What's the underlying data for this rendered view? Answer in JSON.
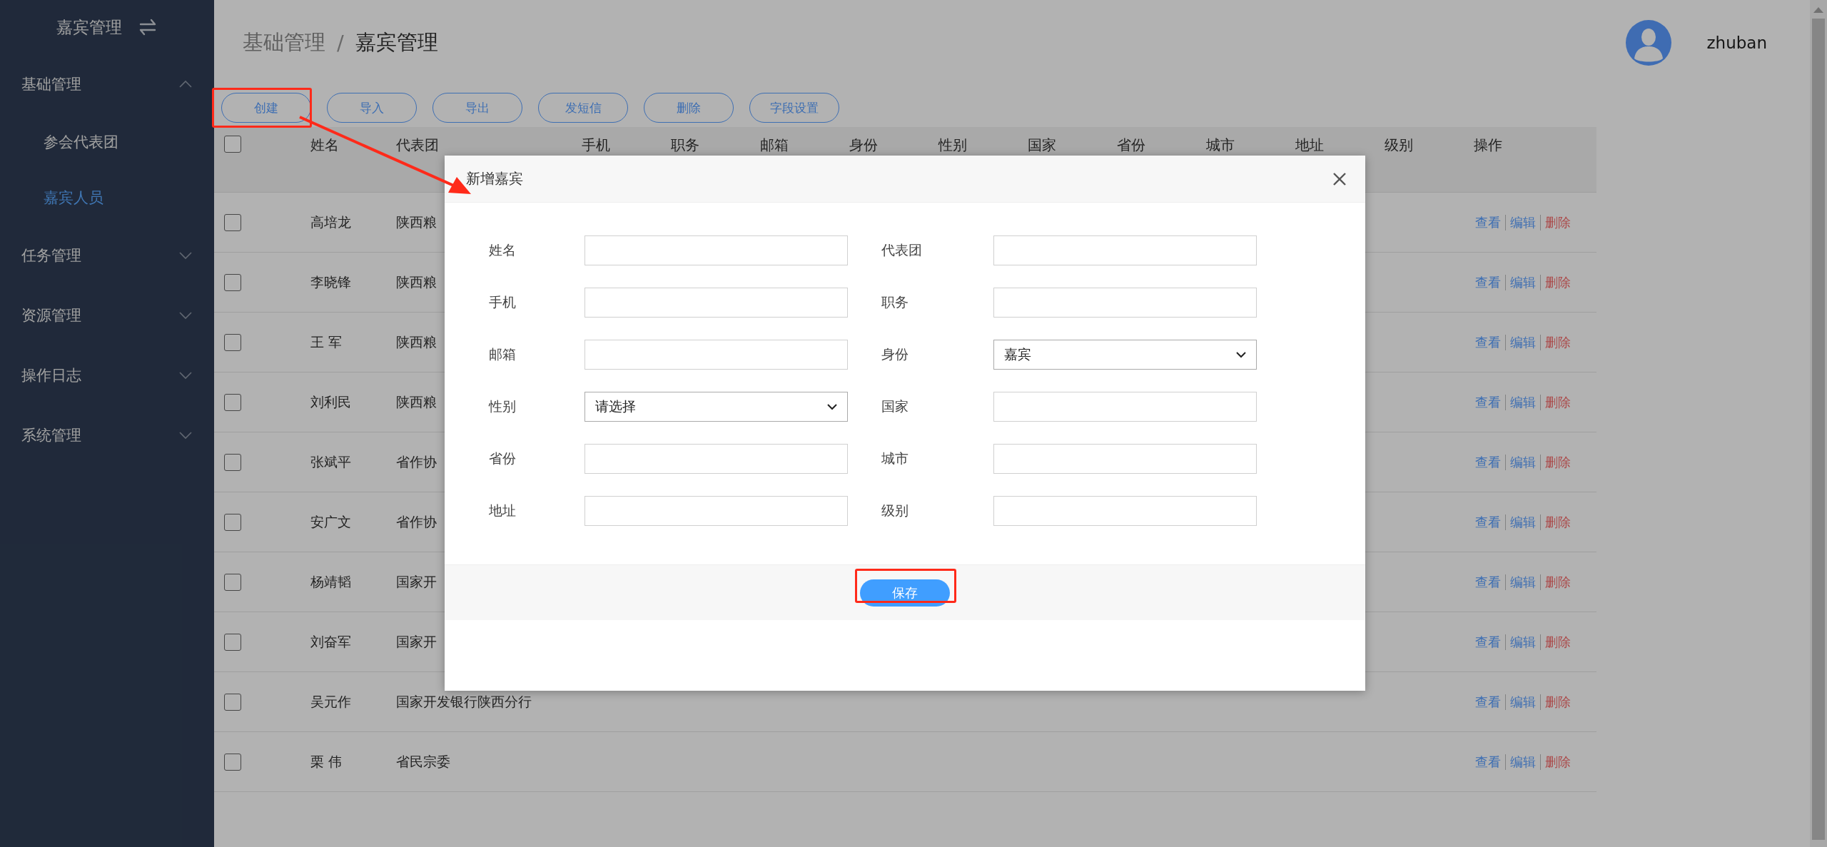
{
  "sidebar": {
    "title": "嘉宾管理",
    "items": [
      {
        "label": "基础管理",
        "expanded": true,
        "children": [
          {
            "label": "参会代表团",
            "selected": false
          },
          {
            "label": "嘉宾人员",
            "selected": true
          }
        ]
      },
      {
        "label": "任务管理",
        "expanded": false
      },
      {
        "label": "资源管理",
        "expanded": false
      },
      {
        "label": "操作日志",
        "expanded": false
      },
      {
        "label": "系统管理",
        "expanded": false
      }
    ]
  },
  "breadcrumb": {
    "items": [
      "基础管理",
      "嘉宾管理"
    ],
    "separator": "/"
  },
  "user": {
    "name": "zhuban"
  },
  "toolbar": [
    "创建",
    "导入",
    "导出",
    "发短信",
    "删除",
    "字段设置"
  ],
  "table": {
    "header_checked": false,
    "columns": [
      "姓名",
      "代表团",
      "手机",
      "职务",
      "邮箱",
      "身份",
      "性别",
      "国家",
      "省份",
      "城市",
      "地址",
      "级别",
      "操作"
    ],
    "rows": [
      {
        "checked": false,
        "name": "高培龙",
        "group": "陕西粮",
        "actions": [
          {
            "label": "查看",
            "kind": "link"
          },
          {
            "label": "编辑",
            "kind": "link"
          },
          {
            "label": "删除",
            "kind": "danger"
          }
        ]
      },
      {
        "checked": false,
        "name": "李晓锋",
        "group": "陕西粮",
        "actions": [
          {
            "label": "查看",
            "kind": "link"
          },
          {
            "label": "编辑",
            "kind": "link"
          },
          {
            "label": "删除",
            "kind": "danger"
          }
        ]
      },
      {
        "checked": false,
        "name": "王 军",
        "group": "陕西粮",
        "actions": [
          {
            "label": "查看",
            "kind": "link"
          },
          {
            "label": "编辑",
            "kind": "link"
          },
          {
            "label": "删除",
            "kind": "danger"
          }
        ]
      },
      {
        "checked": false,
        "name": "刘利民",
        "group": "陕西粮",
        "actions": [
          {
            "label": "查看",
            "kind": "link"
          },
          {
            "label": "编辑",
            "kind": "link"
          },
          {
            "label": "删除",
            "kind": "danger"
          }
        ]
      },
      {
        "checked": false,
        "name": "张斌平",
        "group": "省作协",
        "actions": [
          {
            "label": "查看",
            "kind": "link"
          },
          {
            "label": "编辑",
            "kind": "link"
          },
          {
            "label": "删除",
            "kind": "danger"
          }
        ]
      },
      {
        "checked": false,
        "name": "安广文",
        "group": "省作协",
        "actions": [
          {
            "label": "查看",
            "kind": "link"
          },
          {
            "label": "编辑",
            "kind": "link"
          },
          {
            "label": "删除",
            "kind": "danger"
          }
        ]
      },
      {
        "checked": false,
        "name": "杨靖韬",
        "group": "国家开",
        "actions": [
          {
            "label": "查看",
            "kind": "link"
          },
          {
            "label": "编辑",
            "kind": "link"
          },
          {
            "label": "删除",
            "kind": "danger"
          }
        ]
      },
      {
        "checked": false,
        "name": "刘奋军",
        "group": "国家开",
        "actions": [
          {
            "label": "查看",
            "kind": "link"
          },
          {
            "label": "编辑",
            "kind": "link"
          },
          {
            "label": "删除",
            "kind": "danger"
          }
        ]
      },
      {
        "checked": false,
        "name": "吴元作",
        "group": "国家开发银行陕西分行",
        "actions": [
          {
            "label": "查看",
            "kind": "link"
          },
          {
            "label": "编辑",
            "kind": "link"
          },
          {
            "label": "删除",
            "kind": "danger"
          }
        ]
      },
      {
        "checked": false,
        "name": "栗 伟",
        "group": "省民宗委",
        "actions": [
          {
            "label": "查看",
            "kind": "link"
          },
          {
            "label": "编辑",
            "kind": "link"
          },
          {
            "label": "删除",
            "kind": "danger"
          }
        ]
      }
    ]
  },
  "dialog": {
    "title": "新增嘉宾",
    "fields": [
      {
        "label": "姓名",
        "kind": "input"
      },
      {
        "label": "代表团",
        "kind": "input"
      },
      {
        "label": "手机",
        "kind": "input"
      },
      {
        "label": "职务",
        "kind": "input"
      },
      {
        "label": "邮箱",
        "kind": "input"
      },
      {
        "label": "身份",
        "kind": "select",
        "value": "嘉宾"
      },
      {
        "label": "性别",
        "kind": "select",
        "value": "请选择"
      },
      {
        "label": "国家",
        "kind": "input"
      },
      {
        "label": "省份",
        "kind": "input"
      },
      {
        "label": "城市",
        "kind": "input"
      },
      {
        "label": "地址",
        "kind": "input"
      },
      {
        "label": "级别",
        "kind": "input"
      }
    ],
    "save_button": "保存"
  }
}
